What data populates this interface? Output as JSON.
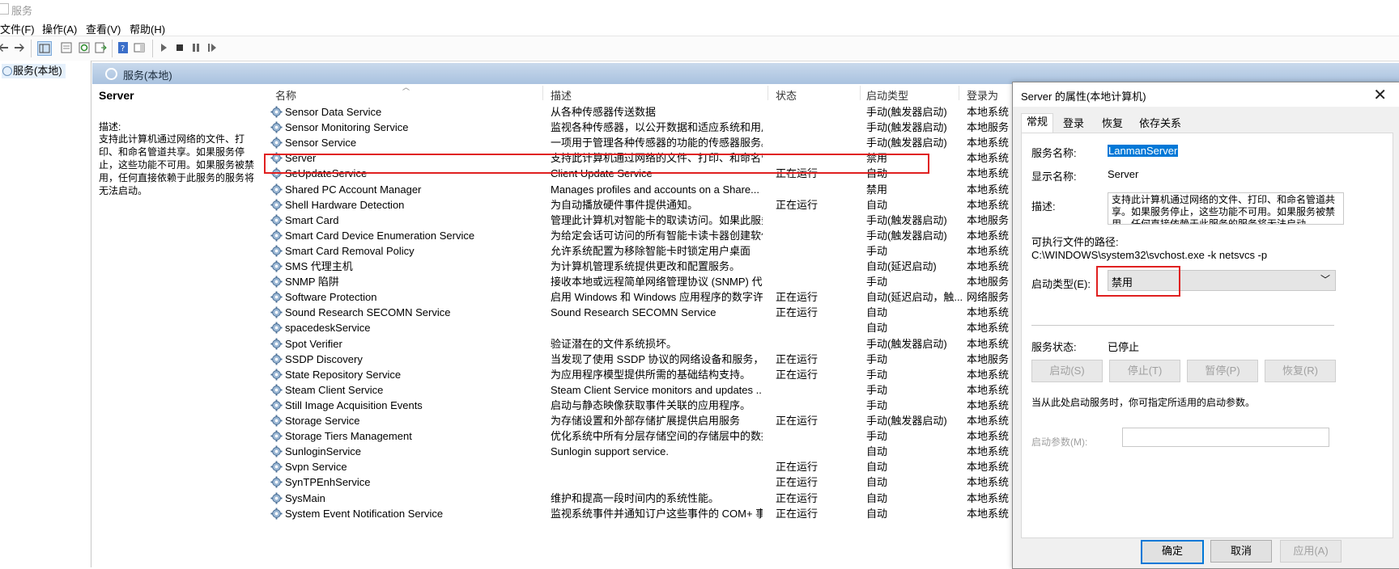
{
  "window": {
    "title": "服务"
  },
  "menu": {
    "file": "文件(F)",
    "action": "操作(A)",
    "view": "查看(V)",
    "help": "帮助(H)"
  },
  "tree": {
    "node": "服务(本地)"
  },
  "header": {
    "title": "服务(本地)"
  },
  "desc_pane": {
    "name": "Server",
    "label": "描述:",
    "text": "支持此计算机通过网络的文件、打印、和命名管道共享。如果服务停止，这些功能不可用。如果服务被禁用，任何直接依赖于此服务的服务将无法启动。"
  },
  "columns": {
    "name": "名称",
    "desc": "描述",
    "status": "状态",
    "startup": "启动类型",
    "logon": "登录为"
  },
  "services": [
    {
      "name": "Sensor Data Service",
      "desc": "从各种传感器传送数据",
      "status": "",
      "startup": "手动(触发器启动)",
      "logon": "本地系统"
    },
    {
      "name": "Sensor Monitoring Service",
      "desc": "监视各种传感器，以公开数据和适应系统和用户...",
      "status": "",
      "startup": "手动(触发器启动)",
      "logon": "本地服务"
    },
    {
      "name": "Sensor Service",
      "desc": "一项用于管理各种传感器的功能的传感器服务。...",
      "status": "",
      "startup": "手动(触发器启动)",
      "logon": "本地系统"
    },
    {
      "name": "Server",
      "desc": "支持此计算机通过网络的文件、打印、和命名管...",
      "status": "",
      "startup": "禁用",
      "logon": "本地系统"
    },
    {
      "name": "SeUpdateService",
      "desc": "Client Update Service",
      "status": "正在运行",
      "startup": "自动",
      "logon": "本地系统"
    },
    {
      "name": "Shared PC Account Manager",
      "desc": "Manages profiles and accounts on a Share...",
      "status": "",
      "startup": "禁用",
      "logon": "本地系统"
    },
    {
      "name": "Shell Hardware Detection",
      "desc": "为自动播放硬件事件提供通知。",
      "status": "正在运行",
      "startup": "自动",
      "logon": "本地系统"
    },
    {
      "name": "Smart Card",
      "desc": "管理此计算机对智能卡的取读访问。如果此服务...",
      "status": "",
      "startup": "手动(触发器启动)",
      "logon": "本地服务"
    },
    {
      "name": "Smart Card Device Enumeration Service",
      "desc": "为给定会话可访问的所有智能卡读卡器创建软件...",
      "status": "",
      "startup": "手动(触发器启动)",
      "logon": "本地系统"
    },
    {
      "name": "Smart Card Removal Policy",
      "desc": "允许系统配置为移除智能卡时锁定用户桌面",
      "status": "",
      "startup": "手动",
      "logon": "本地系统"
    },
    {
      "name": "SMS 代理主机",
      "desc": "为计算机管理系统提供更改和配置服务。",
      "status": "",
      "startup": "自动(延迟启动)",
      "logon": "本地系统"
    },
    {
      "name": "SNMP 陷阱",
      "desc": "接收本地或远程简单网络管理协议 (SNMP) 代理...",
      "status": "",
      "startup": "手动",
      "logon": "本地服务"
    },
    {
      "name": "Software Protection",
      "desc": "启用 Windows 和 Windows 应用程序的数字许...",
      "status": "正在运行",
      "startup": "自动(延迟启动，触...",
      "logon": "网络服务"
    },
    {
      "name": "Sound Research SECOMN Service",
      "desc": "Sound Research SECOMN Service",
      "status": "正在运行",
      "startup": "自动",
      "logon": "本地系统"
    },
    {
      "name": "spacedeskService",
      "desc": "",
      "status": "",
      "startup": "自动",
      "logon": "本地系统"
    },
    {
      "name": "Spot Verifier",
      "desc": "验证潜在的文件系统损坏。",
      "status": "",
      "startup": "手动(触发器启动)",
      "logon": "本地系统"
    },
    {
      "name": "SSDP Discovery",
      "desc": "当发现了使用 SSDP 协议的网络设备和服务，如...",
      "status": "正在运行",
      "startup": "手动",
      "logon": "本地服务"
    },
    {
      "name": "State Repository Service",
      "desc": "为应用程序模型提供所需的基础结构支持。",
      "status": "正在运行",
      "startup": "手动",
      "logon": "本地系统"
    },
    {
      "name": "Steam Client Service",
      "desc": "Steam Client Service monitors and updates ...",
      "status": "",
      "startup": "手动",
      "logon": "本地系统"
    },
    {
      "name": "Still Image Acquisition Events",
      "desc": "启动与静态映像获取事件关联的应用程序。",
      "status": "",
      "startup": "手动",
      "logon": "本地系统"
    },
    {
      "name": "Storage Service",
      "desc": "为存储设置和外部存储扩展提供启用服务",
      "status": "正在运行",
      "startup": "手动(触发器启动)",
      "logon": "本地系统"
    },
    {
      "name": "Storage Tiers Management",
      "desc": "优化系统中所有分层存储空间的存储层中的数据...",
      "status": "",
      "startup": "手动",
      "logon": "本地系统"
    },
    {
      "name": "SunloginService",
      "desc": "Sunlogin support service.",
      "status": "",
      "startup": "自动",
      "logon": "本地系统"
    },
    {
      "name": "Svpn Service",
      "desc": "",
      "status": "正在运行",
      "startup": "自动",
      "logon": "本地系统"
    },
    {
      "name": "SynTPEnhService",
      "desc": "",
      "status": "正在运行",
      "startup": "自动",
      "logon": "本地系统"
    },
    {
      "name": "SysMain",
      "desc": "维护和提高一段时间内的系统性能。",
      "status": "正在运行",
      "startup": "自动",
      "logon": "本地系统"
    },
    {
      "name": "System Event Notification Service",
      "desc": "监视系统事件并通知订户这些事件的 COM+ 事...",
      "status": "正在运行",
      "startup": "自动",
      "logon": "本地系统"
    }
  ],
  "dialog": {
    "title": "Server 的属性(本地计算机)",
    "close": "✕",
    "tabs": [
      "常规",
      "登录",
      "恢复",
      "依存关系"
    ],
    "service_name_label": "服务名称:",
    "service_name": "LanmanServer",
    "display_name_label": "显示名称:",
    "display_name": "Server",
    "desc_label": "描述:",
    "desc_text": "支持此计算机通过网络的文件、打印、和命名管道共享。如果服务停止，这些功能不可用。如果服务被禁用，任何直接依赖于此服务的服务将无法启动",
    "path_label": "可执行文件的路径:",
    "path": "C:\\WINDOWS\\system32\\svchost.exe -k netsvcs -p",
    "startup_label": "启动类型(E):",
    "startup_value": "禁用",
    "status_label": "服务状态:",
    "status_value": "已停止",
    "buttons": {
      "start": "启动(S)",
      "stop": "停止(T)",
      "pause": "暂停(P)",
      "resume": "恢复(R)"
    },
    "hint": "当从此处启动服务时，你可指定所适用的启动参数。",
    "param_label": "启动参数(M):",
    "param_value": "",
    "ok": "确定",
    "cancel": "取消",
    "apply": "应用(A)"
  }
}
